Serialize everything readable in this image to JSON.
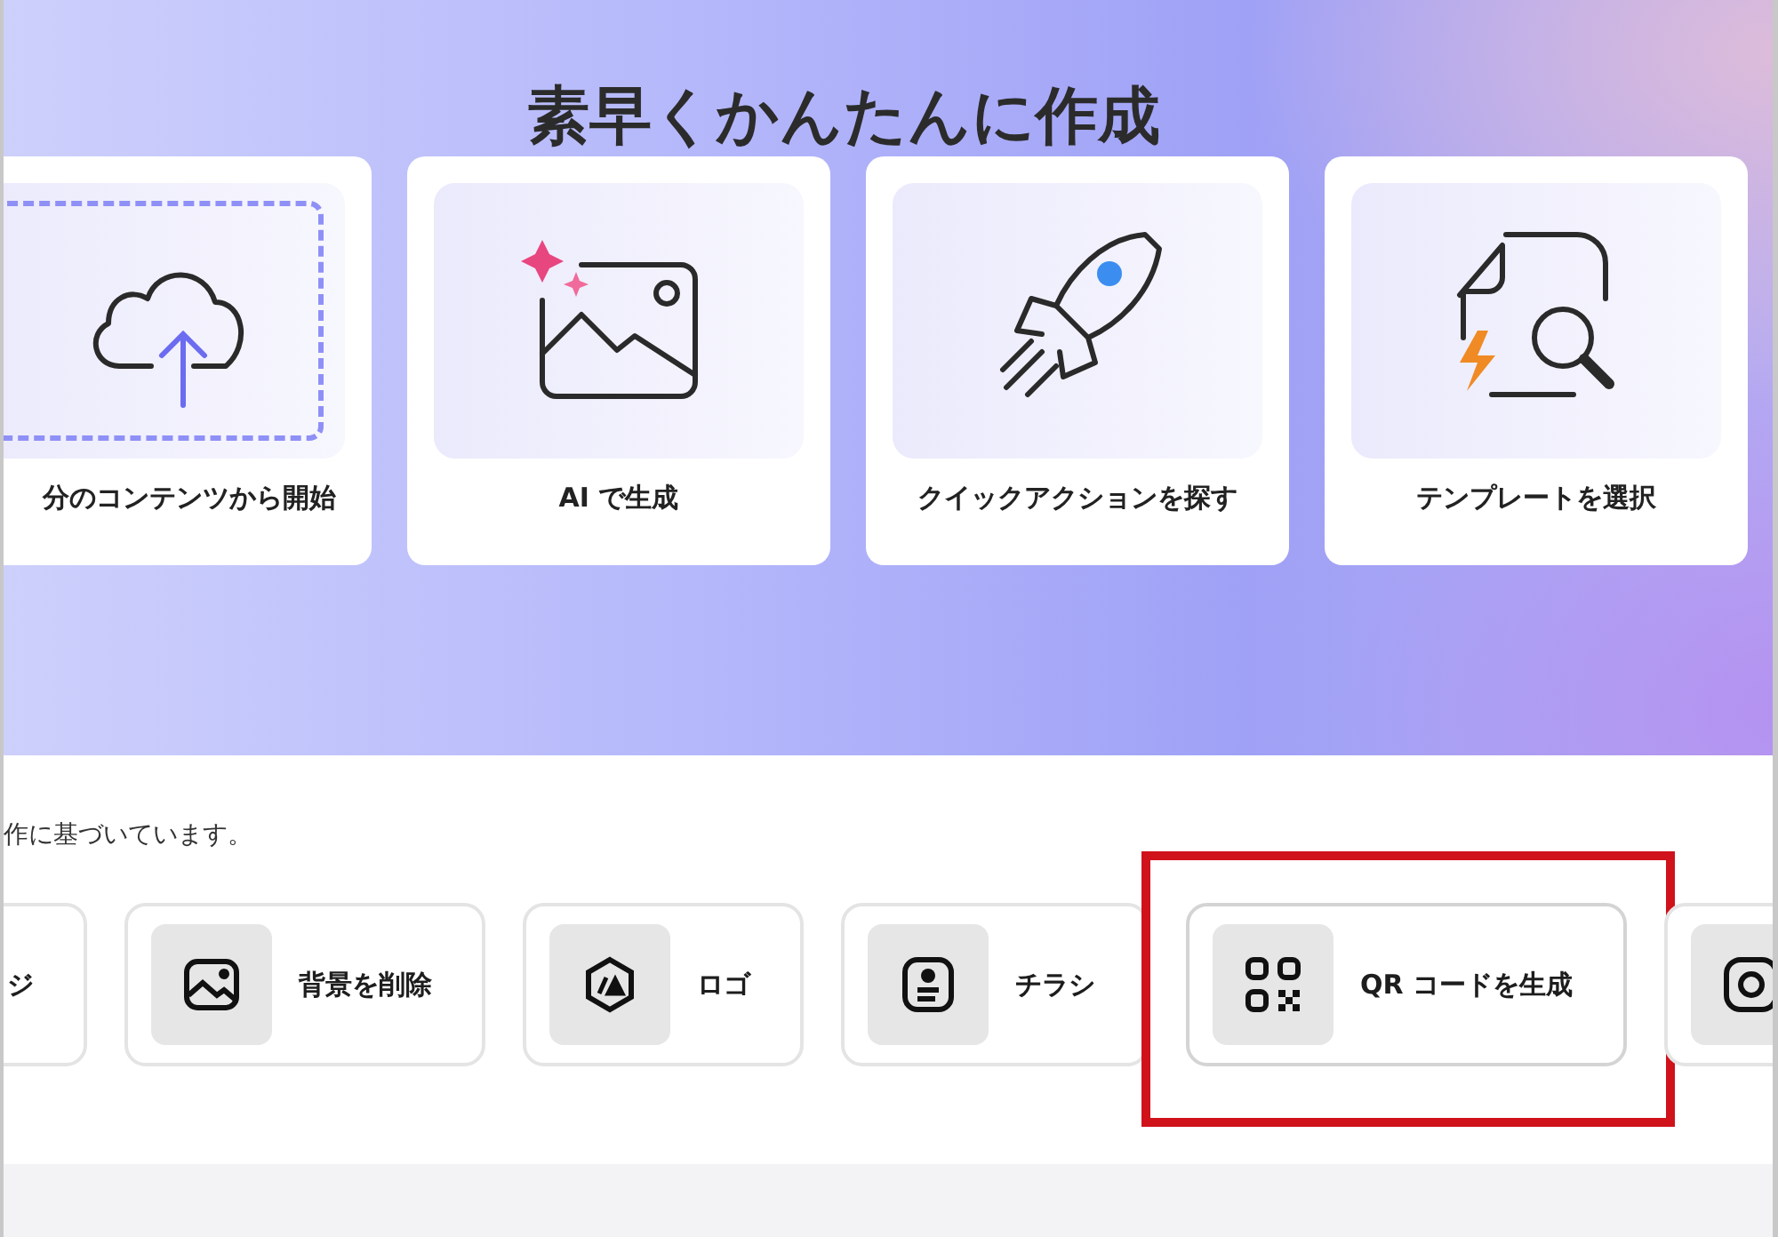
{
  "hero": {
    "title": "素早くかんたんに作成",
    "cards": [
      {
        "label": "分のコンテンツから開始"
      },
      {
        "label": "AI で生成"
      },
      {
        "label": "クイックアクションを探す"
      },
      {
        "label": "テンプレートを選択"
      }
    ]
  },
  "suggestions": {
    "subtitle": "作に基づいています。",
    "pills": [
      {
        "label": "ジ",
        "annotated": false
      },
      {
        "label": "背景を削除",
        "annotated": false
      },
      {
        "label": "ロゴ",
        "annotated": false
      },
      {
        "label": "チラシ",
        "annotated": false
      },
      {
        "label": "QR コードを生成",
        "annotated": true
      },
      {
        "annotated": false
      }
    ]
  }
}
